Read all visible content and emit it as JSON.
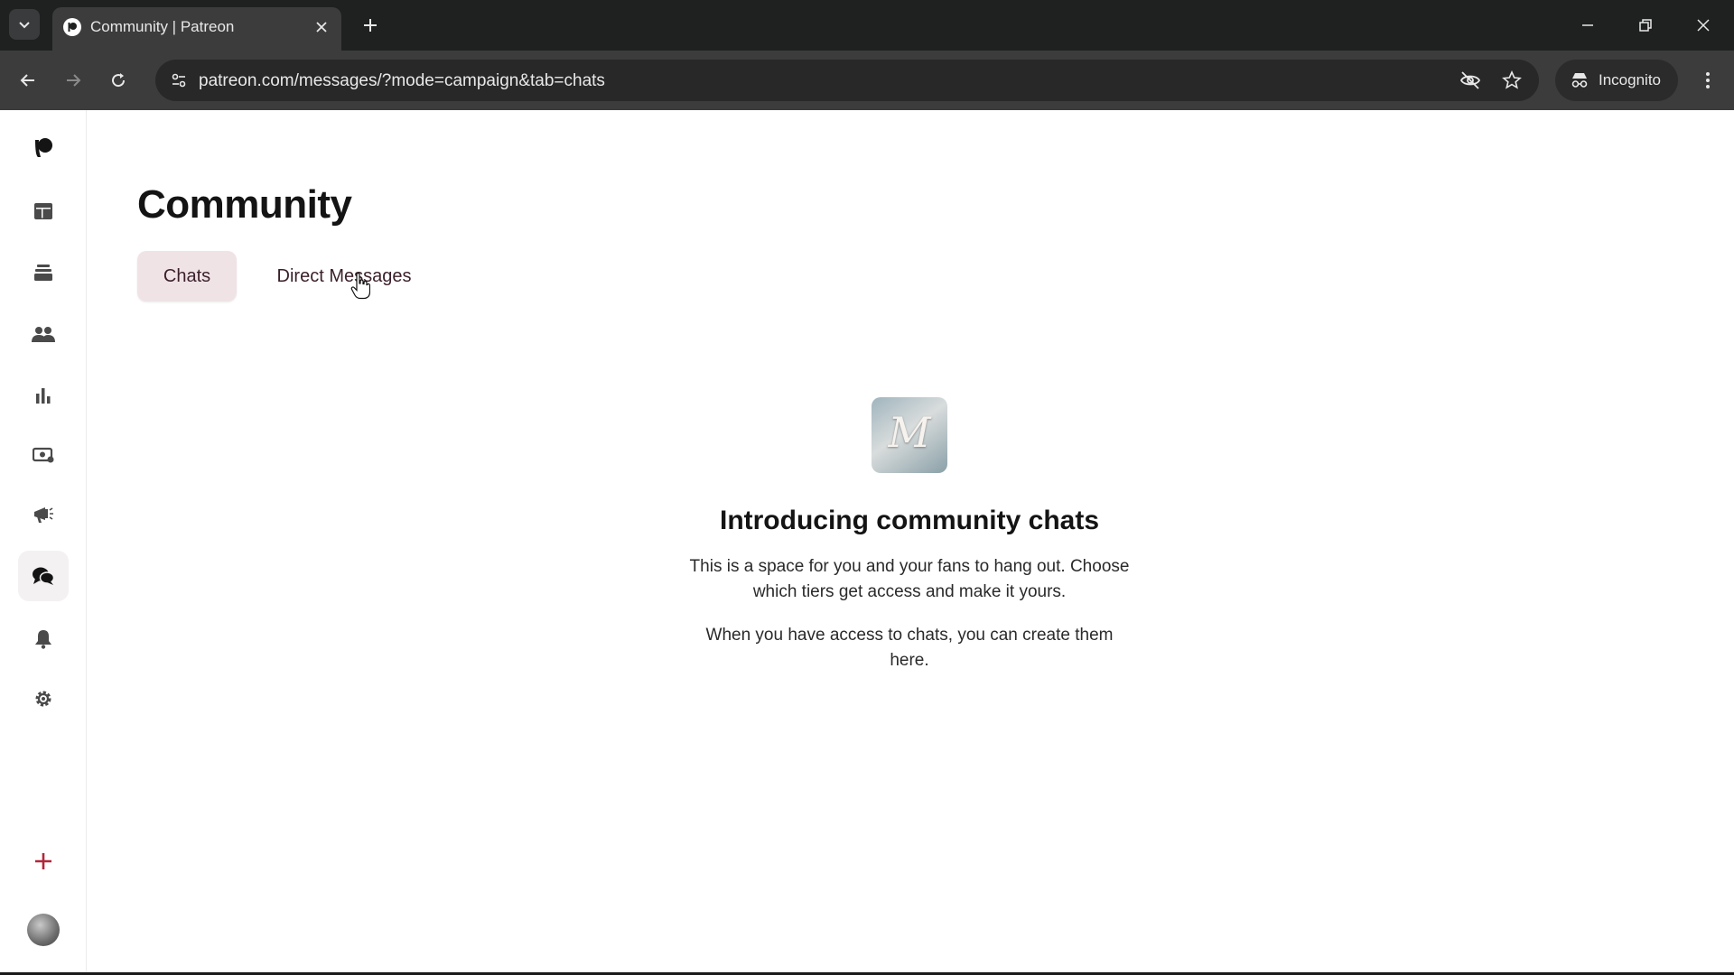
{
  "browser": {
    "tab_title": "Community | Patreon",
    "url": "patreon.com/messages/?mode=campaign&tab=chats",
    "incognito_label": "Incognito"
  },
  "page": {
    "title": "Community",
    "tabs": [
      {
        "label": "Chats",
        "selected": true
      },
      {
        "label": "Direct Messages",
        "selected": false
      }
    ]
  },
  "empty_state": {
    "heading": "Introducing community chats",
    "paragraph1": "This is a space for you and your fans to hang out. Choose which tiers get access and make it yours.",
    "paragraph2": "When you have access to chats, you can create them here.",
    "image_letter": "M"
  },
  "sidebar": {
    "items": [
      {
        "icon": "patreon-logo-icon"
      },
      {
        "icon": "dashboard-icon"
      },
      {
        "icon": "library-icon"
      },
      {
        "icon": "audience-icon"
      },
      {
        "icon": "insights-icon"
      },
      {
        "icon": "payouts-icon"
      },
      {
        "icon": "promotions-icon"
      },
      {
        "icon": "community-chat-icon",
        "active": true
      },
      {
        "icon": "notifications-bell-icon"
      },
      {
        "icon": "settings-gear-icon"
      },
      {
        "icon": "plus-icon"
      }
    ]
  },
  "colors": {
    "accent_tab_bg": "#efe3e6",
    "accent_plus": "#b3263b",
    "chrome_dark": "#1f2020"
  }
}
